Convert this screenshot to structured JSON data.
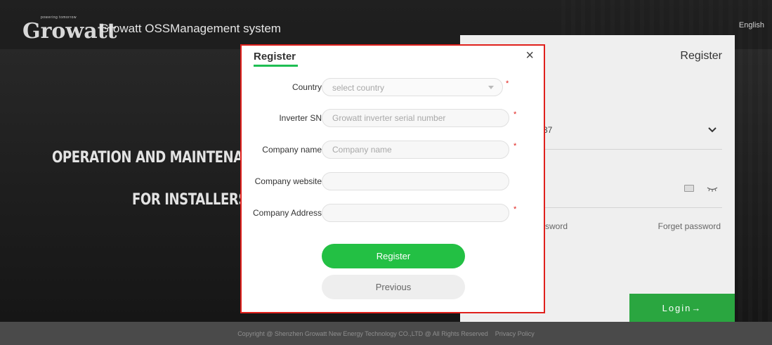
{
  "header": {
    "logo_word": "Growatt",
    "logo_tagline": "powering tomorrow",
    "system_name": "Growatt OSSManagement system",
    "language": "English"
  },
  "hero": {
    "line1": "OPERATION AND MAINTENANCE MA",
    "line2": "FOR INSTALLERS A"
  },
  "login_panel": {
    "title": "Register",
    "username_partial": "37",
    "password_partial": "ssword",
    "forget_password": "Forget password",
    "login_button": "Login→",
    "icons": [
      "chevron-down-icon",
      "keyboard-icon",
      "eye-closed-icon"
    ]
  },
  "modal": {
    "title": "Register",
    "close": "×",
    "fields": {
      "country": {
        "label": "Country",
        "placeholder": "select country",
        "required": true
      },
      "inverter_sn": {
        "label": "Inverter SN",
        "placeholder": "Growatt inverter serial number",
        "required": true
      },
      "company_name": {
        "label": "Company name",
        "placeholder": "Company name",
        "required": true
      },
      "company_website": {
        "label": "Company website",
        "placeholder": "",
        "required": false
      },
      "company_address": {
        "label": "Company Address",
        "placeholder": "",
        "required": true
      }
    },
    "required_mark": "*",
    "register_button": "Register",
    "previous_button": "Previous"
  },
  "footer": {
    "copyright": "Copyright @ Shenzhen Growatt New Energy Technology CO.,LTD @ All Rights Reserved",
    "privacy": "Privacy Policy"
  },
  "colors": {
    "brand_green": "#23c044",
    "login_green": "#2aa640",
    "highlight_red": "#e0201c",
    "underline_green": "#1fbe53"
  }
}
